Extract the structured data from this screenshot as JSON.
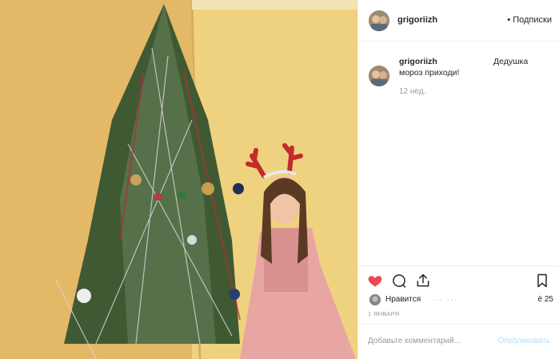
{
  "post": {
    "username": "grigoriizh",
    "follow_label": "• Подписки",
    "photo_description_icon": "photo-icon"
  },
  "caption": {
    "username": "grigoriizh",
    "text_line1": "Дедушка",
    "text_line2": "мороз приходи!",
    "time": "12 нед."
  },
  "actions": {
    "like_icon": "heart-filled-icon",
    "comment_icon": "comment-icon",
    "share_icon": "share-icon",
    "save_icon": "bookmark-icon"
  },
  "likes": {
    "label": "Нравится",
    "faded_text": "... ...",
    "count": "ё 25"
  },
  "date": "1 ЯНВАРЯ",
  "comment_box": {
    "placeholder": "Добавьте комментарий...",
    "publish_label": "Опубликовать"
  },
  "colors": {
    "like_red": "#ed4956",
    "publish_blue": "#b2dffc",
    "border": "#efefef",
    "muted": "#999999"
  }
}
